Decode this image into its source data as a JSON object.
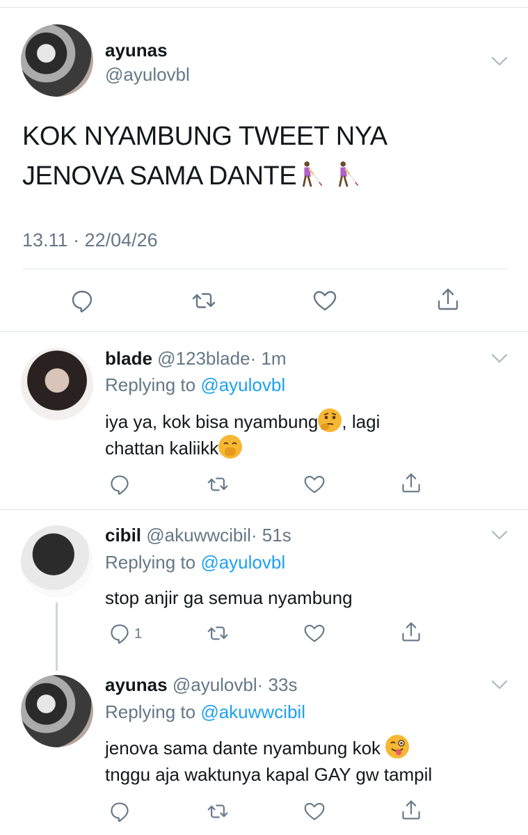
{
  "main_tweet": {
    "name": "ayunas",
    "handle": "@ayulovbl",
    "text_line1": "KOK NYAMBUNG TWEET NYA",
    "text_line2": "JENOVA SAMA DANTE",
    "timestamp": "13.11 · 22/04/26"
  },
  "replies": [
    {
      "name": "blade",
      "handle": "@123blade",
      "time": "· 1m",
      "replying_prefix": "Replying to ",
      "replying_to": "@ayulovbl",
      "line1": "iya ya, kok bisa nyambung",
      "line1_suffix": ", lagi",
      "line2": "chattan kaliikk"
    },
    {
      "name": "cibil",
      "handle": "@akuwwcibil",
      "time": "· 51s",
      "replying_prefix": "Replying to ",
      "replying_to": "@ayulovbl",
      "line1": "stop anjir ga semua nyambung",
      "reply_count": "1"
    },
    {
      "name": "ayunas",
      "handle": "@ayulovbl",
      "time": "· 33s",
      "replying_prefix": "Replying to ",
      "replying_to": "@akuwwcibil",
      "line1": "jenova sama dante nyambung kok",
      "line2": "tnggu aja waktunya kapal GAY gw tampil"
    }
  ],
  "icons": {
    "reply": "reply-icon",
    "retweet": "retweet-icon",
    "like": "heart-icon",
    "share": "share-icon",
    "more": "chevron-down-icon"
  },
  "colors": {
    "text": "#14171a",
    "secondary": "#657786",
    "link": "#1da1f2",
    "divider": "#e1e8ed"
  }
}
